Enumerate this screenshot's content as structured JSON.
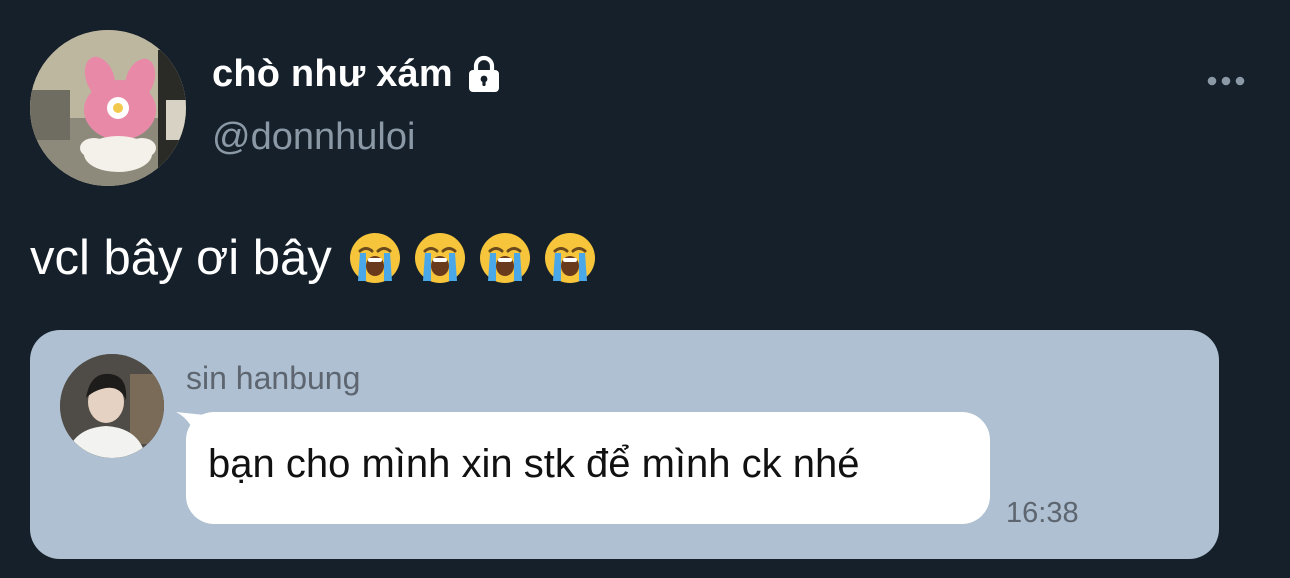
{
  "tweet": {
    "author": {
      "display_name": "chò như xám",
      "handle": "@donnhuloi",
      "protected_icon": "lock-icon",
      "avatar_icon": "avatar"
    },
    "more_icon": "more-options-icon",
    "text": "vcl bây ơi bây",
    "emojis": [
      "😭",
      "😭",
      "😭",
      "😭"
    ]
  },
  "media": {
    "chat": {
      "sender_name": "sin hanbung",
      "message": "bạn cho mình xin stk để mình ck nhé",
      "time": "16:38"
    }
  },
  "colors": {
    "background": "#15202b",
    "secondary_text": "#8b98a5",
    "media_background": "#aec0d1",
    "bubble": "#ffffff"
  }
}
